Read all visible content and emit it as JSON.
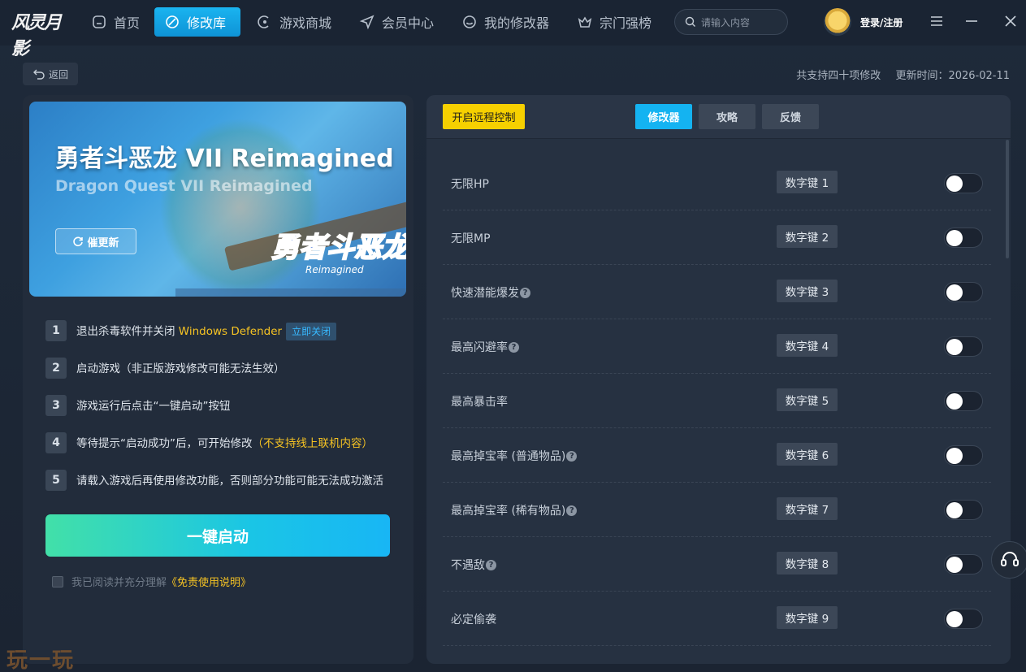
{
  "app": {
    "logo_text": "风灵月影"
  },
  "nav": {
    "items": [
      {
        "label": "首页",
        "icon": "home-icon"
      },
      {
        "label": "修改库",
        "icon": "library-icon"
      },
      {
        "label": "游戏商城",
        "icon": "store-icon"
      },
      {
        "label": "会员中心",
        "icon": "member-icon"
      },
      {
        "label": "我的修改器",
        "icon": "my-trainer-icon"
      },
      {
        "label": "宗门强榜",
        "icon": "crown-icon"
      }
    ],
    "active_index": 1
  },
  "search": {
    "placeholder": "请输入内容"
  },
  "user": {
    "login_label": "登录/注册"
  },
  "header": {
    "back_label": "返回",
    "support_count": "共支持四十项修改",
    "update_time": "更新时间：2026-02-11"
  },
  "banner": {
    "title": "勇者斗恶龙 VII Reimagined",
    "subtitle": "Dragon Quest VII Reimagined",
    "logo_text": "勇者斗恶龙",
    "logo_sub": "Reimagined",
    "update_label": "催更新"
  },
  "steps": [
    {
      "num": "1",
      "text": "退出杀毒软件并关闭 ",
      "highlight": "Windows Defender",
      "button": "立即关闭"
    },
    {
      "num": "2",
      "text": "启动游戏（非正版游戏修改可能无法生效）"
    },
    {
      "num": "3",
      "text": "游戏运行后点击“一键启动”按钮"
    },
    {
      "num": "4",
      "text": "等待提示“启动成功”后，可开始修改",
      "highlight": "（不支持线上联机内容）"
    },
    {
      "num": "5",
      "text": "请载入游戏后再使用修改功能，否则部分功能可能无法成功激活"
    }
  ],
  "start_label": "一键启动",
  "agree": {
    "text": "我已阅读并充分理解",
    "link": "《免责使用说明》"
  },
  "watermark": "玩一玩",
  "right": {
    "remote_label": "开启远程控制",
    "tabs": [
      "修改器",
      "攻略",
      "反馈"
    ],
    "active_tab": 0
  },
  "cheats": [
    {
      "name": "无限HP",
      "help": false,
      "hotkey": "数字键 1",
      "enabled": false
    },
    {
      "name": "无限MP",
      "help": false,
      "hotkey": "数字键 2",
      "enabled": false
    },
    {
      "name": "快速潜能爆发",
      "help": true,
      "hotkey": "数字键 3",
      "enabled": false
    },
    {
      "name": "最高闪避率",
      "help": true,
      "hotkey": "数字键 4",
      "enabled": false
    },
    {
      "name": "最高暴击率",
      "help": false,
      "hotkey": "数字键 5",
      "enabled": false
    },
    {
      "name": "最高掉宝率 (普通物品)",
      "help": true,
      "hotkey": "数字键 6",
      "enabled": false
    },
    {
      "name": "最高掉宝率 (稀有物品)",
      "help": true,
      "hotkey": "数字键 7",
      "enabled": false
    },
    {
      "name": "不遇敌",
      "help": true,
      "hotkey": "数字键 8",
      "enabled": false
    },
    {
      "name": "必定偷袭",
      "help": false,
      "hotkey": "数字键 9",
      "enabled": false
    }
  ],
  "colors": {
    "accent": "#14b3f1",
    "highlight": "#f6c323",
    "remote_button": "#f6d000"
  }
}
